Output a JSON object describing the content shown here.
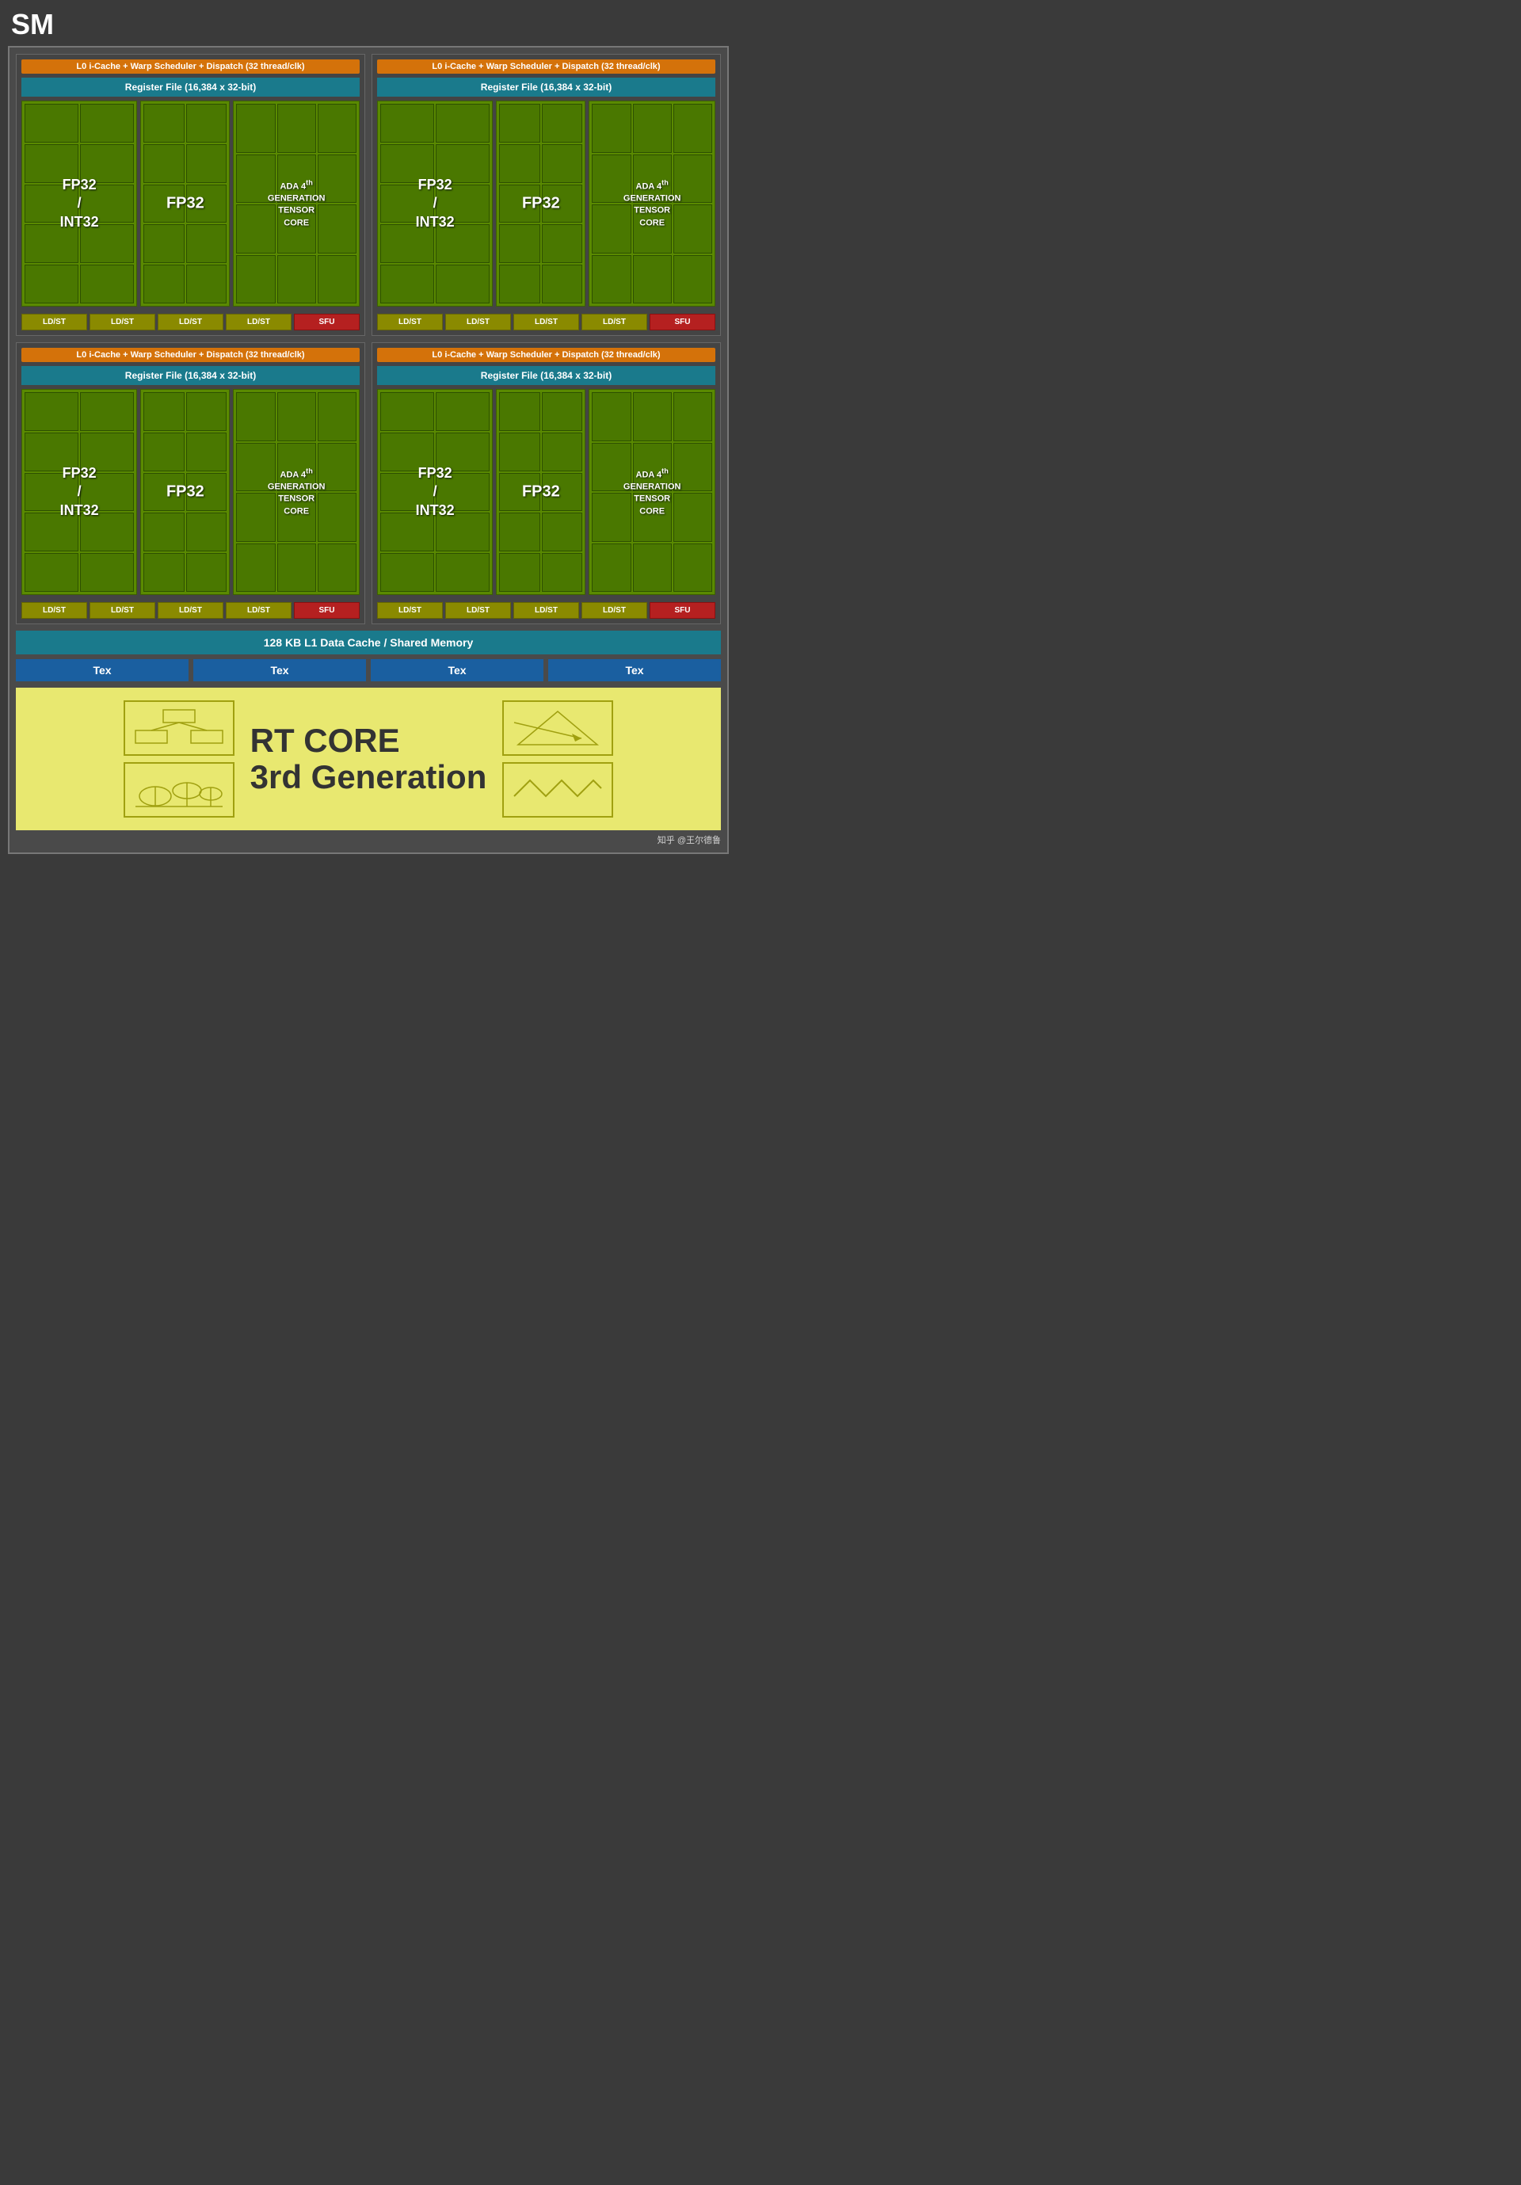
{
  "title": "SM",
  "quadrants": [
    {
      "id": "q1",
      "warp_label": "L0 i-Cache + Warp Scheduler + Dispatch (32 thread/clk)",
      "register_label": "Register File (16,384 x 32-bit)",
      "fp32_int32_label": "FP32\n/\nINT32",
      "fp32_label": "FP32",
      "tensor_label": "ADA 4th GENERATION TENSOR CORE",
      "bottom_units": [
        "LD/ST",
        "LD/ST",
        "LD/ST",
        "LD/ST",
        "SFU"
      ]
    },
    {
      "id": "q2",
      "warp_label": "L0 i-Cache + Warp Scheduler + Dispatch (32 thread/clk)",
      "register_label": "Register File (16,384 x 32-bit)",
      "fp32_int32_label": "FP32\n/\nINT32",
      "fp32_label": "FP32",
      "tensor_label": "ADA 4th GENERATION TENSOR CORE",
      "bottom_units": [
        "LD/ST",
        "LD/ST",
        "LD/ST",
        "LD/ST",
        "SFU"
      ]
    },
    {
      "id": "q3",
      "warp_label": "L0 i-Cache + Warp Scheduler + Dispatch (32 thread/clk)",
      "register_label": "Register File (16,384 x 32-bit)",
      "fp32_int32_label": "FP32\n/\nINT32",
      "fp32_label": "FP32",
      "tensor_label": "ADA 4th GENERATION TENSOR CORE",
      "bottom_units": [
        "LD/ST",
        "LD/ST",
        "LD/ST",
        "LD/ST",
        "SFU"
      ]
    },
    {
      "id": "q4",
      "warp_label": "L0 i-Cache + Warp Scheduler + Dispatch (32 thread/clk)",
      "register_label": "Register File (16,384 x 32-bit)",
      "fp32_int32_label": "FP32\n/\nINT32",
      "fp32_label": "FP32",
      "tensor_label": "ADA 4th GENERATION TENSOR CORE",
      "bottom_units": [
        "LD/ST",
        "LD/ST",
        "LD/ST",
        "LD/ST",
        "SFU"
      ]
    }
  ],
  "l1_cache_label": "128 KB L1 Data Cache / Shared Memory",
  "tex_labels": [
    "Tex",
    "Tex",
    "Tex",
    "Tex"
  ],
  "rt_core_line1": "RT CORE",
  "rt_core_line2": "3rd Generation",
  "watermark": "知乎 @王尔德鲁",
  "colors": {
    "warp_bar": "#d4720a",
    "register_bar": "#1a7a8c",
    "green_panel": "#6aaa00",
    "green_dark": "#4a7800",
    "sfu": "#b52020",
    "ldst": "#8a8a10",
    "tex": "#1a5fa0",
    "l1": "#1a7a8c",
    "rt_bg": "#e8e870",
    "rt_text": "#333333",
    "bg_outer": "#4a4a4a",
    "bg_inner": "#3a3a3a"
  }
}
